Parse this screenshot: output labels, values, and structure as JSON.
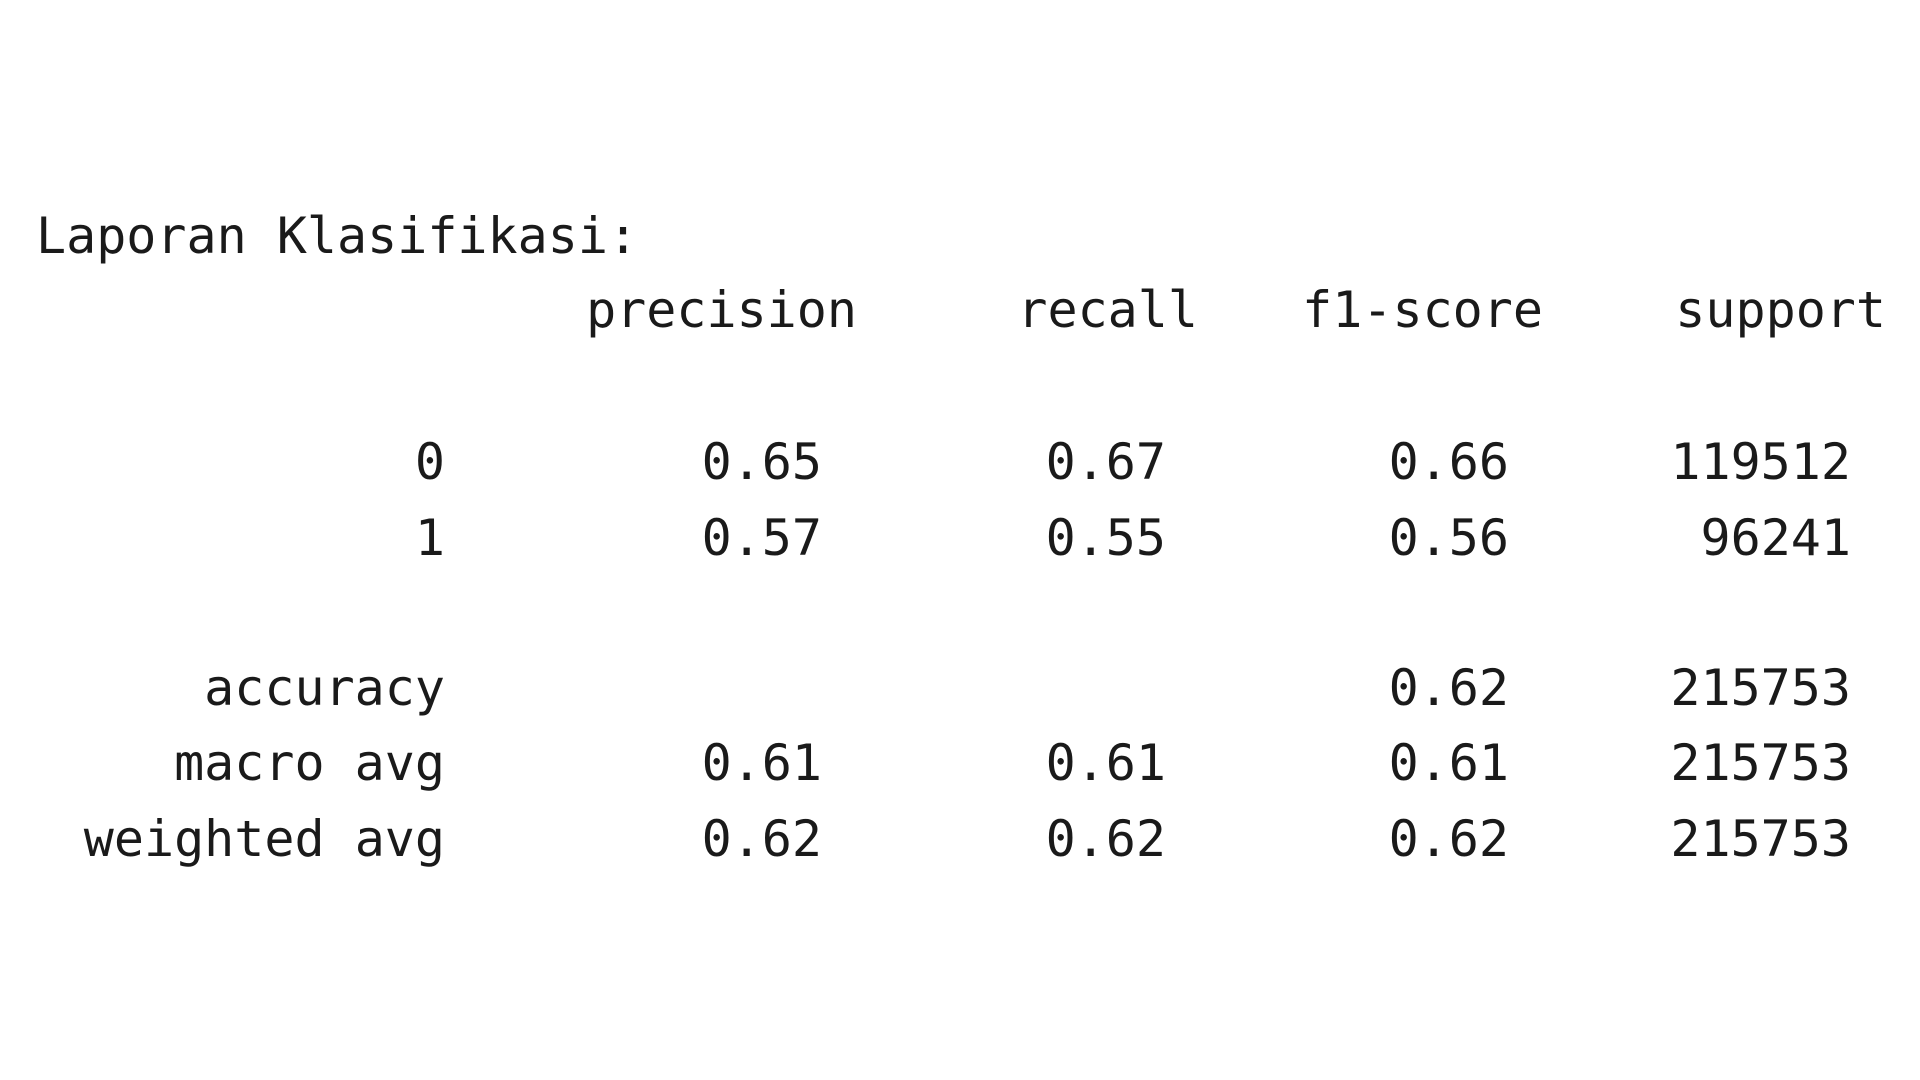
{
  "title": "Laporan Klasifikasi:",
  "headers": {
    "precision": "precision",
    "recall": "recall",
    "f1": "f1-score",
    "support": "support"
  },
  "rows": [
    {
      "label": "0",
      "precision": "0.65",
      "recall": "0.67",
      "f1": "0.66",
      "support": "119512"
    },
    {
      "label": "1",
      "precision": "0.57",
      "recall": "0.55",
      "f1": "0.56",
      "support": "96241"
    }
  ],
  "summary": [
    {
      "label": "accuracy",
      "precision": "",
      "recall": "",
      "f1": "0.62",
      "support": "215753"
    },
    {
      "label": "macro avg",
      "precision": "0.61",
      "recall": "0.61",
      "f1": "0.61",
      "support": "215753"
    },
    {
      "label": "weighted avg",
      "precision": "0.62",
      "recall": "0.62",
      "f1": "0.62",
      "support": "215753"
    }
  ]
}
